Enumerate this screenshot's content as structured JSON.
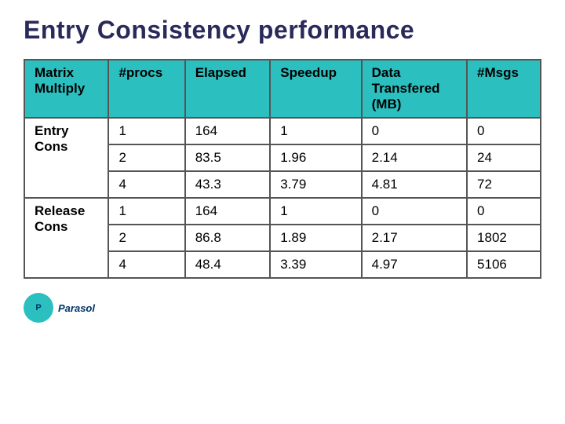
{
  "title": "Entry  Consistency performance",
  "table": {
    "headers": [
      {
        "label": "Matrix\nMultiply",
        "sub": null
      },
      {
        "label": "#procs",
        "sub": null
      },
      {
        "label": "Elapsed",
        "sub": null
      },
      {
        "label": "Speedup",
        "sub": null
      },
      {
        "label": "Data\nTransfered\n(MB)",
        "sub": null
      },
      {
        "label": "#Msgs",
        "sub": null
      }
    ],
    "row_groups": [
      {
        "label": "Entry\nCons",
        "rows": [
          {
            "procs": "1",
            "elapsed": "164",
            "speedup": "1",
            "data": "0",
            "msgs": "0"
          },
          {
            "procs": "2",
            "elapsed": "83.5",
            "speedup": "1.96",
            "data": "2.14",
            "msgs": "24"
          },
          {
            "procs": "4",
            "elapsed": "43.3",
            "speedup": "3.79",
            "data": "4.81",
            "msgs": "72"
          }
        ]
      },
      {
        "label": "Release\nCons",
        "rows": [
          {
            "procs": "1",
            "elapsed": "164",
            "speedup": "1",
            "data": "0",
            "msgs": "0"
          },
          {
            "procs": "2",
            "elapsed": "86.8",
            "speedup": "1.89",
            "data": "2.17",
            "msgs": "1802"
          },
          {
            "procs": "4",
            "elapsed": "48.4",
            "speedup": "3.39",
            "data": "4.97",
            "msgs": "5106"
          }
        ]
      }
    ]
  },
  "logo": {
    "text": "Parasol",
    "icon": "P"
  }
}
